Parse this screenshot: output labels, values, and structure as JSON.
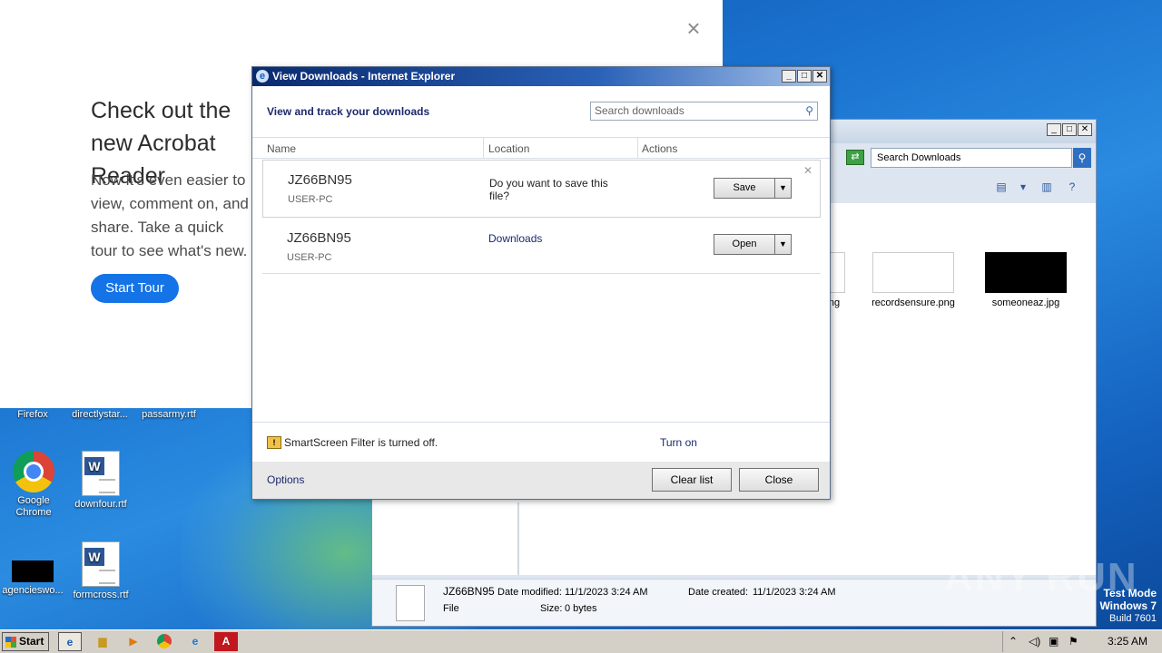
{
  "acrobat": {
    "headline": "Check out the new Acrobat Reader",
    "body": "Now it's even easier to view, comment on, and share. Take a quick tour to see what's new.",
    "start_tour": "Start Tour",
    "close": "×"
  },
  "desktop_icons": {
    "firefox": "Firefox",
    "directlystar": "directlystar...",
    "passarmy": "passarmy.rtf",
    "chrome": "Google Chrome",
    "downfour": "downfour.rtf",
    "agencies": "agencieswo...",
    "formcross": "formcross.rtf"
  },
  "explorer": {
    "search_placeholder": "Search Downloads",
    "files": [
      {
        "name": "ng"
      },
      {
        "name": "recordsensure.png"
      },
      {
        "name": "someoneaz.jpg"
      }
    ],
    "details": {
      "name": "JZ66BN95",
      "type": "File",
      "modified_label": "Date modified:",
      "modified_value": "11/1/2023 3:24 AM",
      "size_label": "Size:",
      "size_value": "0 bytes",
      "created_label": "Date created:",
      "created_value": "11/1/2023 3:24 AM"
    }
  },
  "dialog": {
    "title": "View Downloads - Internet Explorer",
    "header": "View and track your downloads",
    "search_placeholder": "Search downloads",
    "columns": {
      "name": "Name",
      "location": "Location",
      "actions": "Actions"
    },
    "items": [
      {
        "name": "JZ66BN95",
        "host": "USER-PC",
        "location": "Do you want to save this file?",
        "action": "Save"
      },
      {
        "name": "JZ66BN95",
        "host": "USER-PC",
        "location": "Downloads",
        "action": "Open"
      }
    ],
    "smartscreen_text": "SmartScreen Filter is turned off.",
    "turn_on": "Turn on",
    "options": "Options",
    "clear_list": "Clear list",
    "close": "Close"
  },
  "watermark": "ANY RUN",
  "test_mode": {
    "line1": "Test Mode",
    "line2": "Windows 7",
    "line3": "Build 7601"
  },
  "taskbar": {
    "start": "Start",
    "clock": "3:25 AM"
  }
}
